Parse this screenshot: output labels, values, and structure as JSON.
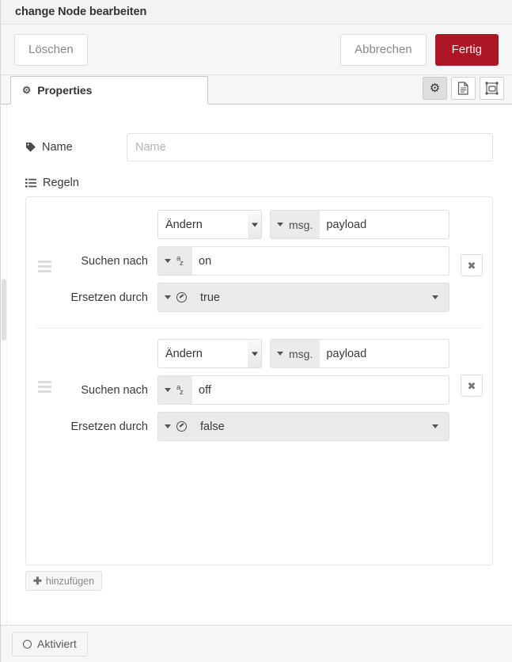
{
  "titlebar": {
    "title": "change Node bearbeiten"
  },
  "actions": {
    "delete_label": "Löschen",
    "cancel_label": "Abbrechen",
    "done_label": "Fertig",
    "done_color": "#ad1625"
  },
  "tabs": [
    {
      "label": "Properties",
      "icon": "gear-icon",
      "active": true
    }
  ],
  "tab_icons": [
    {
      "name": "gear-icon",
      "active": true
    },
    {
      "name": "description-icon",
      "active": false
    },
    {
      "name": "appearance-icon",
      "active": false
    }
  ],
  "form": {
    "name_label": "Name",
    "name_icon": "tag-icon",
    "name_value": "",
    "name_placeholder": "Name",
    "rules_label": "Regeln",
    "rules_icon": "list-icon"
  },
  "rules": [
    {
      "action": "Ändern",
      "property": {
        "type_prefix": "msg.",
        "type_icon": "msg-icon",
        "value": "payload"
      },
      "search_label": "Suchen nach",
      "search": {
        "type_icon": "string-az-icon",
        "value": "on"
      },
      "replace_label": "Ersetzen durch",
      "replace": {
        "type_icon": "boolean-icon",
        "value": "true"
      },
      "delete_icon": "close-icon",
      "grip_icon": "drag-handle-icon"
    },
    {
      "action": "Ändern",
      "property": {
        "type_prefix": "msg.",
        "type_icon": "msg-icon",
        "value": "payload"
      },
      "search_label": "Suchen nach",
      "search": {
        "type_icon": "string-az-icon",
        "value": "off"
      },
      "replace_label": "Ersetzen durch",
      "replace": {
        "type_icon": "boolean-icon",
        "value": "false"
      },
      "delete_icon": "close-icon",
      "grip_icon": "drag-handle-icon"
    }
  ],
  "add_rule": {
    "label": "hinzufügen",
    "icon": "plus-icon"
  },
  "footer": {
    "enabled_label": "Aktiviert",
    "icon": "circle-icon"
  }
}
